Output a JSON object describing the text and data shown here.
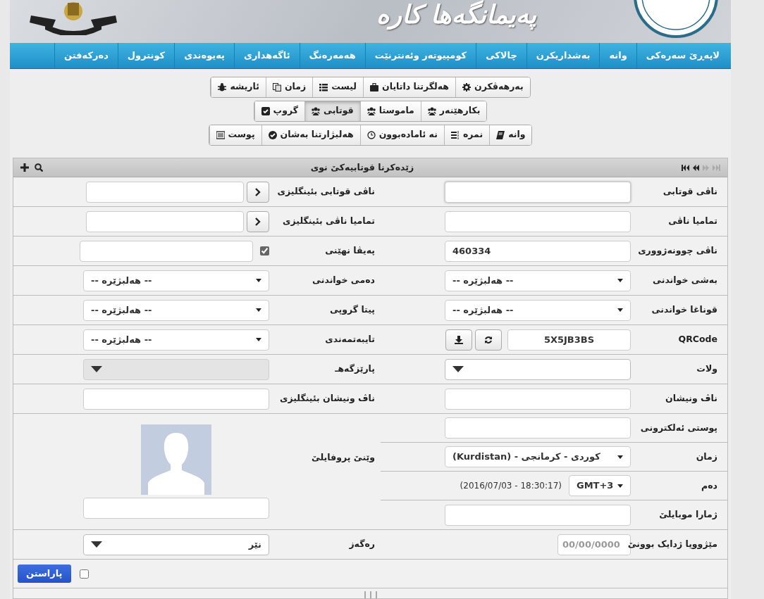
{
  "header": {
    "title": "پەیمانگەها کارە"
  },
  "nav": [
    {
      "label": "لاپەڕێ سەرەکی"
    },
    {
      "label": "وانە"
    },
    {
      "label": "بەشداریکرن"
    },
    {
      "label": "چالاکی"
    },
    {
      "label": "کومپیوتەر وئەنترنێت"
    },
    {
      "label": "هەمەرەنگ"
    },
    {
      "label": "ئاگەهداری"
    },
    {
      "label": "پەیوەندی"
    },
    {
      "label": "کونترول"
    },
    {
      "label": "دەرکەفتن"
    }
  ],
  "toolbar_rows": [
    [
      {
        "label": "بەرهەڤکرن",
        "selected": false
      },
      {
        "label": "هەلگرتنا داتایان",
        "selected": false
      },
      {
        "label": "لیست",
        "selected": false
      },
      {
        "label": "زمان",
        "selected": false
      },
      {
        "label": "ئاریشە",
        "selected": false
      }
    ],
    [
      {
        "label": "بکارهێنەر",
        "selected": false
      },
      {
        "label": "ماموستا",
        "selected": false
      },
      {
        "label": "قوتابی",
        "selected": true
      },
      {
        "label": "گروپ",
        "selected": false
      }
    ],
    [
      {
        "label": "وانە",
        "selected": false
      },
      {
        "label": "نمرە",
        "selected": false
      },
      {
        "label": "نە ئامادەبوون",
        "selected": false
      },
      {
        "label": "هەلبژارتنا بەشان",
        "selected": false
      },
      {
        "label": "پوست",
        "selected": false
      }
    ]
  ],
  "form": {
    "title": "زێدەکرنا قوتابیەکێ نوی",
    "rows": [
      {
        "right": {
          "label": "ناڤی قوتابی",
          "kind": "text",
          "focused": true
        },
        "left": {
          "label": "ناڤی قوتابی بئینگلیزی",
          "kind": "text_button"
        }
      },
      {
        "right": {
          "label": "تماميا ناڤی",
          "kind": "text"
        },
        "left": {
          "label": "تماميا ناڤی بئینگلیزی",
          "kind": "text_button"
        }
      },
      {
        "right": {
          "label": "ناڤی چوونەژووری",
          "kind": "text",
          "value": "460334"
        },
        "left": {
          "label": "پەیڤا نهێنی",
          "kind": "checkbox_text",
          "checked": true
        }
      },
      {
        "right": {
          "label": "بەشی خواندنی",
          "kind": "select",
          "value": "-- هەلبژێرە --"
        },
        "left": {
          "label": "دەمی خواندنی",
          "kind": "select",
          "value": "-- هەلبژێرە --"
        }
      },
      {
        "right": {
          "label": "قوناغا خواندنی",
          "kind": "select",
          "value": "-- هەلبژێرە --"
        },
        "left": {
          "label": "پیتا گروپی",
          "kind": "select",
          "value": "-- هەلبژێرە --"
        }
      },
      {
        "right": {
          "label": "QRCode",
          "kind": "qrcode",
          "value": "5X5JB3BS"
        },
        "left": {
          "label": "تایبەتمەندی",
          "kind": "select",
          "value": "-- هەلبژێرە --"
        }
      },
      {
        "right": {
          "label": "ولات",
          "kind": "dropdown",
          "disabled": false
        },
        "left": {
          "label": "پارێزگەهـ",
          "kind": "dropdown",
          "disabled": true
        }
      },
      {
        "right": {
          "label": "ناڤ ونیشان",
          "kind": "text"
        },
        "left": {
          "label": "ناڤ ونیشان بئینگلیزی",
          "kind": "text"
        }
      }
    ],
    "profile": {
      "photo_label": "وێنێ پروفایلێ",
      "rows": [
        {
          "label": "پوستی ئەلکترونی",
          "kind": "text"
        },
        {
          "label": "زمان",
          "kind": "select",
          "value": "کوردی - کرمانجی - (Kurdistan)"
        },
        {
          "label": "دەم",
          "kind": "timezone",
          "value": "GMT+3",
          "note": "(2016/07/03 - 18:30:17)"
        },
        {
          "label": "ژمارا موبایلێ",
          "kind": "text"
        }
      ]
    },
    "last_row": {
      "right": {
        "label": "مێژوویا ژدایک بوونێ",
        "kind": "date",
        "placeholder": "00/00/0000"
      },
      "left": {
        "label": "رەگەز",
        "kind": "dropdown",
        "value": "نێر",
        "disabled": false
      }
    },
    "save_button": "پاراستن",
    "save_checked": false
  }
}
